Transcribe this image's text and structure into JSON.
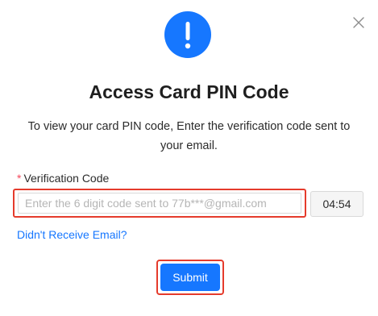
{
  "dialog": {
    "title": "Access Card PIN Code",
    "description": "To view your card PIN code, Enter the verification code sent to your email.",
    "alert_icon": "exclamation-icon",
    "close_icon": "close-icon",
    "accent_color": "#1677ff",
    "highlight_color": "#e53b2c"
  },
  "form": {
    "required_marker": "*",
    "field_label": "Verification Code",
    "code_value": "",
    "code_placeholder": "Enter the 6 digit code sent to 77b***@gmail.com",
    "countdown": "04:54",
    "resend_link": "Didn't Receive Email?",
    "submit_label": "Submit"
  }
}
